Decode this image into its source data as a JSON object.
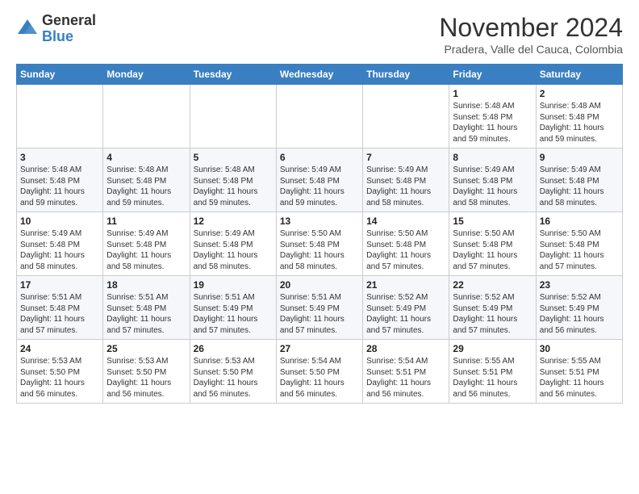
{
  "logo": {
    "general": "General",
    "blue": "Blue"
  },
  "header": {
    "month": "November 2024",
    "location": "Pradera, Valle del Cauca, Colombia"
  },
  "weekdays": [
    "Sunday",
    "Monday",
    "Tuesday",
    "Wednesday",
    "Thursday",
    "Friday",
    "Saturday"
  ],
  "weeks": [
    [
      {
        "day": "",
        "info": ""
      },
      {
        "day": "",
        "info": ""
      },
      {
        "day": "",
        "info": ""
      },
      {
        "day": "",
        "info": ""
      },
      {
        "day": "",
        "info": ""
      },
      {
        "day": "1",
        "info": "Sunrise: 5:48 AM\nSunset: 5:48 PM\nDaylight: 11 hours and 59 minutes."
      },
      {
        "day": "2",
        "info": "Sunrise: 5:48 AM\nSunset: 5:48 PM\nDaylight: 11 hours and 59 minutes."
      }
    ],
    [
      {
        "day": "3",
        "info": "Sunrise: 5:48 AM\nSunset: 5:48 PM\nDaylight: 11 hours and 59 minutes."
      },
      {
        "day": "4",
        "info": "Sunrise: 5:48 AM\nSunset: 5:48 PM\nDaylight: 11 hours and 59 minutes."
      },
      {
        "day": "5",
        "info": "Sunrise: 5:48 AM\nSunset: 5:48 PM\nDaylight: 11 hours and 59 minutes."
      },
      {
        "day": "6",
        "info": "Sunrise: 5:49 AM\nSunset: 5:48 PM\nDaylight: 11 hours and 59 minutes."
      },
      {
        "day": "7",
        "info": "Sunrise: 5:49 AM\nSunset: 5:48 PM\nDaylight: 11 hours and 58 minutes."
      },
      {
        "day": "8",
        "info": "Sunrise: 5:49 AM\nSunset: 5:48 PM\nDaylight: 11 hours and 58 minutes."
      },
      {
        "day": "9",
        "info": "Sunrise: 5:49 AM\nSunset: 5:48 PM\nDaylight: 11 hours and 58 minutes."
      }
    ],
    [
      {
        "day": "10",
        "info": "Sunrise: 5:49 AM\nSunset: 5:48 PM\nDaylight: 11 hours and 58 minutes."
      },
      {
        "day": "11",
        "info": "Sunrise: 5:49 AM\nSunset: 5:48 PM\nDaylight: 11 hours and 58 minutes."
      },
      {
        "day": "12",
        "info": "Sunrise: 5:49 AM\nSunset: 5:48 PM\nDaylight: 11 hours and 58 minutes."
      },
      {
        "day": "13",
        "info": "Sunrise: 5:50 AM\nSunset: 5:48 PM\nDaylight: 11 hours and 58 minutes."
      },
      {
        "day": "14",
        "info": "Sunrise: 5:50 AM\nSunset: 5:48 PM\nDaylight: 11 hours and 57 minutes."
      },
      {
        "day": "15",
        "info": "Sunrise: 5:50 AM\nSunset: 5:48 PM\nDaylight: 11 hours and 57 minutes."
      },
      {
        "day": "16",
        "info": "Sunrise: 5:50 AM\nSunset: 5:48 PM\nDaylight: 11 hours and 57 minutes."
      }
    ],
    [
      {
        "day": "17",
        "info": "Sunrise: 5:51 AM\nSunset: 5:48 PM\nDaylight: 11 hours and 57 minutes."
      },
      {
        "day": "18",
        "info": "Sunrise: 5:51 AM\nSunset: 5:48 PM\nDaylight: 11 hours and 57 minutes."
      },
      {
        "day": "19",
        "info": "Sunrise: 5:51 AM\nSunset: 5:49 PM\nDaylight: 11 hours and 57 minutes."
      },
      {
        "day": "20",
        "info": "Sunrise: 5:51 AM\nSunset: 5:49 PM\nDaylight: 11 hours and 57 minutes."
      },
      {
        "day": "21",
        "info": "Sunrise: 5:52 AM\nSunset: 5:49 PM\nDaylight: 11 hours and 57 minutes."
      },
      {
        "day": "22",
        "info": "Sunrise: 5:52 AM\nSunset: 5:49 PM\nDaylight: 11 hours and 57 minutes."
      },
      {
        "day": "23",
        "info": "Sunrise: 5:52 AM\nSunset: 5:49 PM\nDaylight: 11 hours and 56 minutes."
      }
    ],
    [
      {
        "day": "24",
        "info": "Sunrise: 5:53 AM\nSunset: 5:50 PM\nDaylight: 11 hours and 56 minutes."
      },
      {
        "day": "25",
        "info": "Sunrise: 5:53 AM\nSunset: 5:50 PM\nDaylight: 11 hours and 56 minutes."
      },
      {
        "day": "26",
        "info": "Sunrise: 5:53 AM\nSunset: 5:50 PM\nDaylight: 11 hours and 56 minutes."
      },
      {
        "day": "27",
        "info": "Sunrise: 5:54 AM\nSunset: 5:50 PM\nDaylight: 11 hours and 56 minutes."
      },
      {
        "day": "28",
        "info": "Sunrise: 5:54 AM\nSunset: 5:51 PM\nDaylight: 11 hours and 56 minutes."
      },
      {
        "day": "29",
        "info": "Sunrise: 5:55 AM\nSunset: 5:51 PM\nDaylight: 11 hours and 56 minutes."
      },
      {
        "day": "30",
        "info": "Sunrise: 5:55 AM\nSunset: 5:51 PM\nDaylight: 11 hours and 56 minutes."
      }
    ]
  ]
}
